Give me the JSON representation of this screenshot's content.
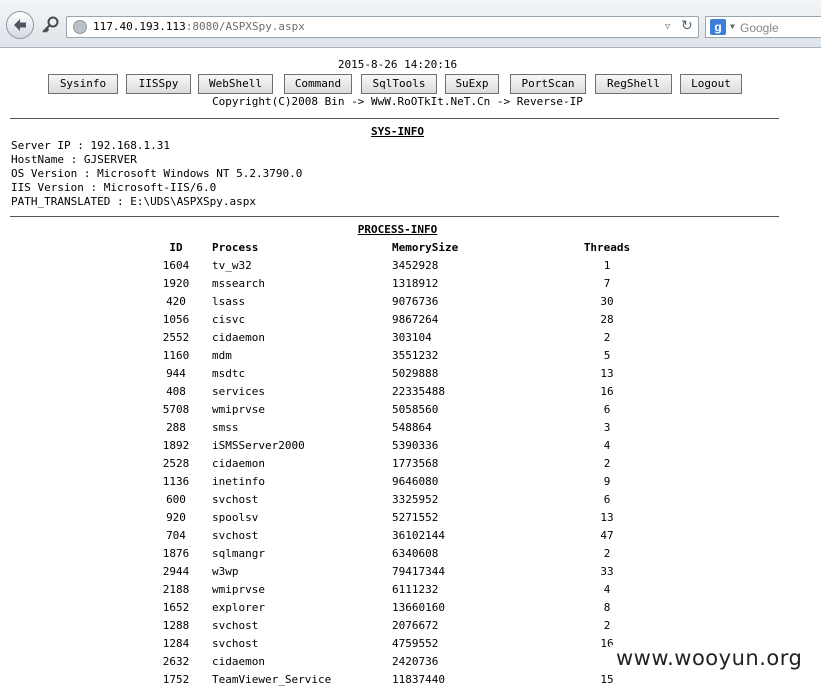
{
  "browser": {
    "url_host": "117.40.193.113",
    "url_rest": ":8080/ASPXSpy.aspx",
    "search_placeholder": "Google",
    "search_engine_letter": "g"
  },
  "header": {
    "datetime": "2015-8-26 14:20:16",
    "copyright": "Copyright(C)2008 Bin -> WwW.RoOTkIt.NeT.Cn -> Reverse-IP"
  },
  "nav": {
    "buttons": [
      "Sysinfo",
      "IISSpy",
      "WebShell",
      "Command",
      "SqlTools",
      "SuExp",
      "PortScan",
      "RegShell",
      "Logout"
    ]
  },
  "sysinfo": {
    "title": "SYS-INFO",
    "lines": [
      "Server IP : 192.168.1.31",
      "HostName : GJSERVER",
      "OS Version : Microsoft Windows NT 5.2.3790.0",
      "IIS Version : Microsoft-IIS/6.0",
      "PATH_TRANSLATED : E:\\UDS\\ASPXSpy.aspx"
    ]
  },
  "processinfo": {
    "title": "PROCESS-INFO",
    "columns": [
      "ID",
      "Process",
      "MemorySize",
      "Threads"
    ],
    "rows": [
      [
        "1604",
        "tv_w32",
        "3452928",
        "1"
      ],
      [
        "1920",
        "mssearch",
        "1318912",
        "7"
      ],
      [
        "420",
        "lsass",
        "9076736",
        "30"
      ],
      [
        "1056",
        "cisvc",
        "9867264",
        "28"
      ],
      [
        "2552",
        "cidaemon",
        "303104",
        "2"
      ],
      [
        "1160",
        "mdm",
        "3551232",
        "5"
      ],
      [
        "944",
        "msdtc",
        "5029888",
        "13"
      ],
      [
        "408",
        "services",
        "22335488",
        "16"
      ],
      [
        "5708",
        "wmiprvse",
        "5058560",
        "6"
      ],
      [
        "288",
        "smss",
        "548864",
        "3"
      ],
      [
        "1892",
        "iSMSServer2000",
        "5390336",
        "4"
      ],
      [
        "2528",
        "cidaemon",
        "1773568",
        "2"
      ],
      [
        "1136",
        "inetinfo",
        "9646080",
        "9"
      ],
      [
        "600",
        "svchost",
        "3325952",
        "6"
      ],
      [
        "920",
        "spoolsv",
        "5271552",
        "13"
      ],
      [
        "704",
        "svchost",
        "36102144",
        "47"
      ],
      [
        "1876",
        "sqlmangr",
        "6340608",
        "2"
      ],
      [
        "2944",
        "w3wp",
        "79417344",
        "33"
      ],
      [
        "2188",
        "wmiprvse",
        "6111232",
        "4"
      ],
      [
        "1652",
        "explorer",
        "13660160",
        "8"
      ],
      [
        "1288",
        "svchost",
        "2076672",
        "2"
      ],
      [
        "1284",
        "svchost",
        "4759552",
        "16"
      ],
      [
        "2632",
        "cidaemon",
        "2420736",
        ""
      ],
      [
        "1752",
        "TeamViewer_Service",
        "11837440",
        "15"
      ]
    ]
  },
  "watermark": "www.wooyun.org"
}
